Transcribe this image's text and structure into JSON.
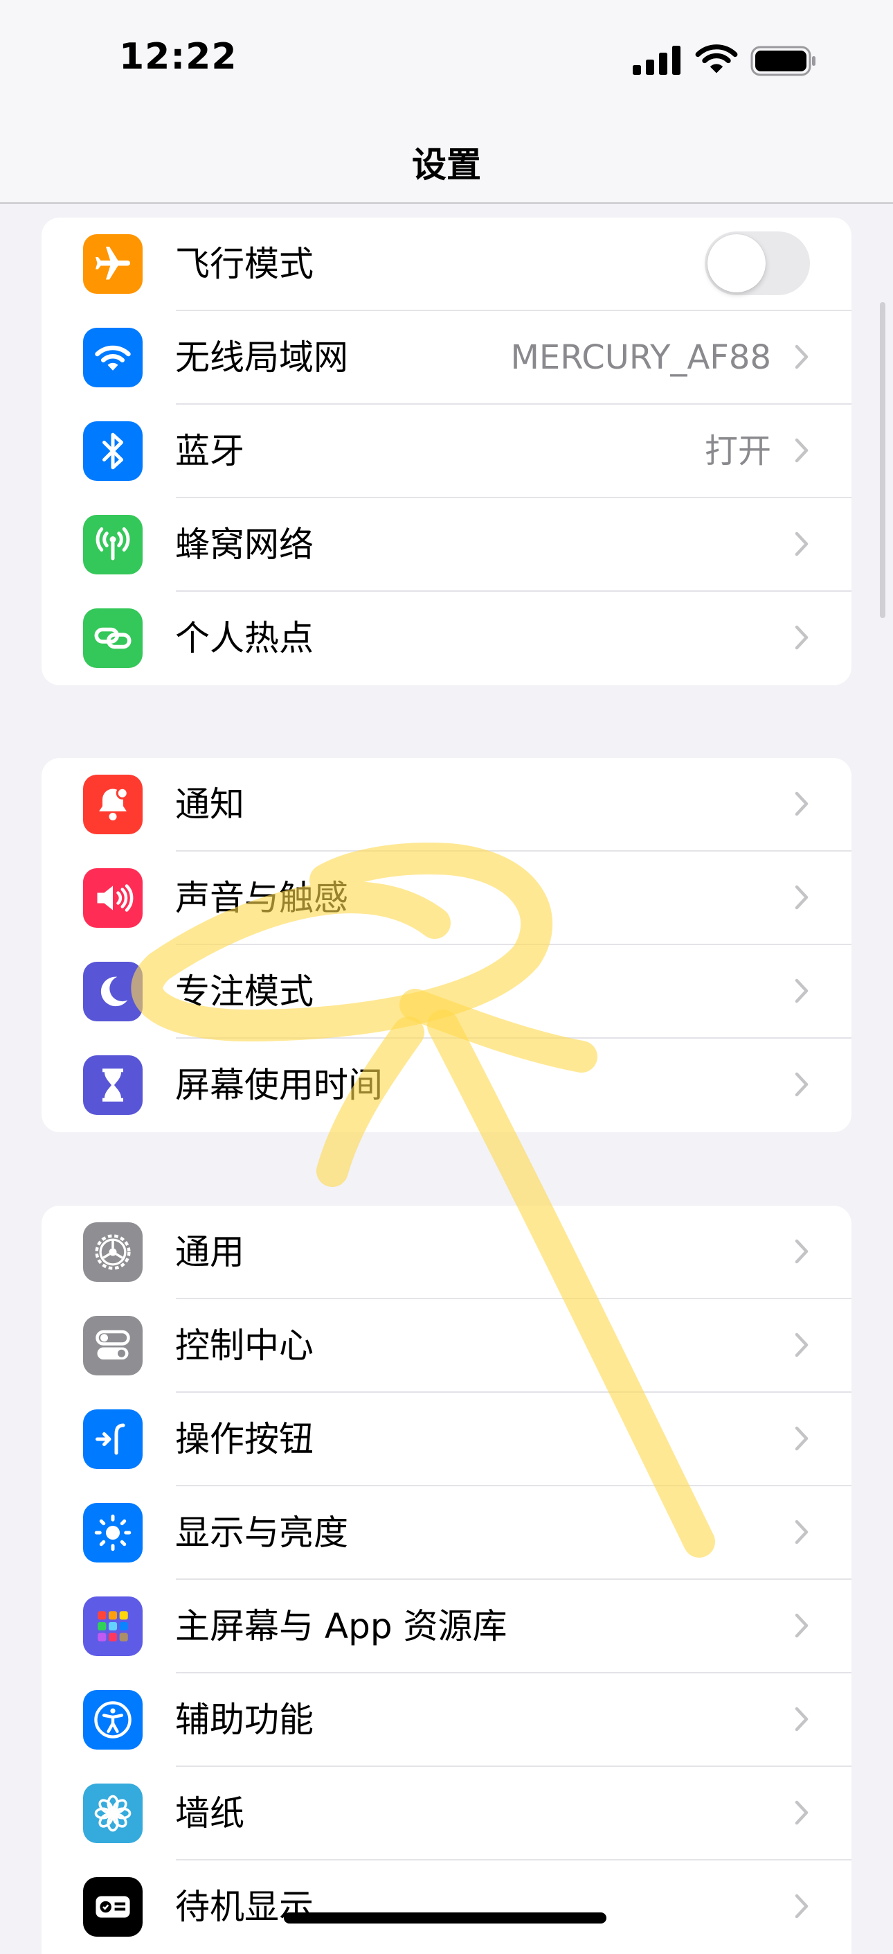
{
  "status_bar": {
    "time": "12:22"
  },
  "nav": {
    "title": "设置"
  },
  "groups": [
    {
      "rows": [
        {
          "key": "airplane",
          "label": "飞行模式",
          "icon": "airplane-icon",
          "color": "#ff9500",
          "toggle": false
        },
        {
          "key": "wifi",
          "label": "无线局域网",
          "detail": "MERCURY_AF88",
          "icon": "wifi-icon",
          "color": "#007aff"
        },
        {
          "key": "bluetooth",
          "label": "蓝牙",
          "detail": "打开",
          "icon": "bluetooth-icon",
          "color": "#007aff"
        },
        {
          "key": "cellular",
          "label": "蜂窝网络",
          "icon": "antenna-icon",
          "color": "#34c759"
        },
        {
          "key": "hotspot",
          "label": "个人热点",
          "icon": "link-icon",
          "color": "#34c759"
        }
      ]
    },
    {
      "rows": [
        {
          "key": "notifications",
          "label": "通知",
          "icon": "bell-icon",
          "color": "#ff3b30"
        },
        {
          "key": "sounds",
          "label": "声音与触感",
          "icon": "speaker-icon",
          "color": "#ff2d55"
        },
        {
          "key": "focus",
          "label": "专注模式",
          "icon": "moon-icon",
          "color": "#5856d6"
        },
        {
          "key": "screen-time",
          "label": "屏幕使用时间",
          "icon": "hourglass-icon",
          "color": "#5856d6"
        }
      ]
    },
    {
      "rows": [
        {
          "key": "general",
          "label": "通用",
          "icon": "gear-icon",
          "color": "#8e8e93"
        },
        {
          "key": "control-center",
          "label": "控制中心",
          "icon": "switches-icon",
          "color": "#8e8e93"
        },
        {
          "key": "action-button",
          "label": "操作按钮",
          "icon": "action-button-icon",
          "color": "#007aff"
        },
        {
          "key": "display",
          "label": "显示与亮度",
          "icon": "sun-icon",
          "color": "#007aff"
        },
        {
          "key": "home-screen",
          "label": "主屏幕与 App 资源库",
          "icon": "app-grid-icon",
          "color": "#5e5ce6"
        },
        {
          "key": "accessibility",
          "label": "辅助功能",
          "icon": "accessibility-icon",
          "color": "#007aff"
        },
        {
          "key": "wallpaper",
          "label": "墙纸",
          "icon": "flower-icon",
          "color": "#35aadc"
        },
        {
          "key": "standby",
          "label": "待机显示",
          "icon": "standby-icon",
          "color": "#000000"
        }
      ]
    }
  ],
  "annotation": {
    "color": "#ffd84d",
    "shape": "yellow highlighter loop with upward arrow"
  }
}
